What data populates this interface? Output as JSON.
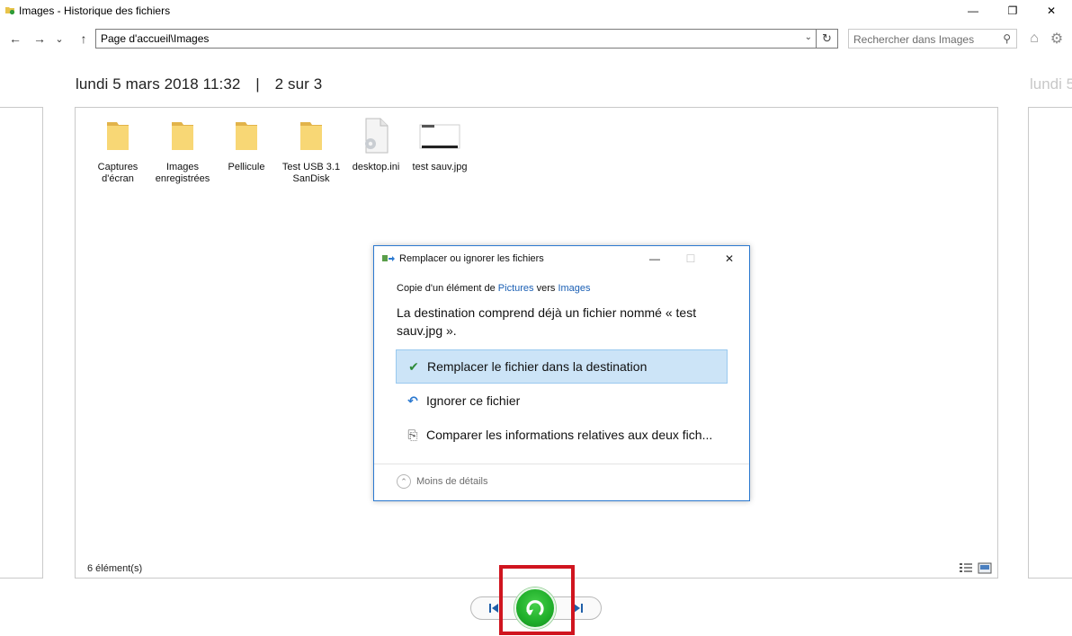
{
  "window": {
    "title": "Images - Historique des fichiers",
    "minimize": "—",
    "restore": "❐",
    "close": "✕"
  },
  "nav": {
    "back": "←",
    "forward": "→",
    "recent": "⌄",
    "up": "↑",
    "address": "Page d'accueil\\Images",
    "address_dropdown": "⌄",
    "refresh": "↻",
    "search_placeholder": "Rechercher dans Images",
    "search_icon": "⚲",
    "home_icon": "⌂",
    "settings_icon": "⚙"
  },
  "snapshot": {
    "date": "lundi 5 mars 2018 11:32",
    "separator": "|",
    "position": "2 sur 3",
    "next_date_peek": "lundi 5"
  },
  "files": [
    {
      "name": "Captures d'écran",
      "type": "folder"
    },
    {
      "name": "Images enregistrées",
      "type": "folder"
    },
    {
      "name": "Pellicule",
      "type": "folder"
    },
    {
      "name": "Test USB 3.1 SanDisk",
      "type": "folder"
    },
    {
      "name": "desktop.ini",
      "type": "settings-file"
    },
    {
      "name": "test sauv.jpg",
      "type": "image"
    }
  ],
  "status": {
    "count": "6 élément(s)"
  },
  "dialog": {
    "title": "Remplacer ou ignorer les fichiers",
    "minimize": "—",
    "maximize": "☐",
    "close": "✕",
    "copy_prefix": "Copie d'un élément de ",
    "copy_source": "Pictures",
    "copy_mid": " vers ",
    "copy_dest": "Images",
    "message": "La destination comprend déjà un fichier nommé « test sauv.jpg ».",
    "options": [
      {
        "icon": "✔",
        "label": "Remplacer le fichier dans la destination",
        "selected": true
      },
      {
        "icon": "↶",
        "label": "Ignorer ce fichier",
        "selected": false
      },
      {
        "icon": "⎘",
        "label": "Comparer les informations relatives aux deux fich...",
        "selected": false
      }
    ],
    "less_details": "Moins de détails",
    "less_icon": "⌃"
  },
  "colors": {
    "accent": "#2b79d0",
    "selection": "#cce4f7",
    "restore_green": "#1fae2a",
    "highlight_red": "#d0151f",
    "folder_yellow": "#f8d775"
  }
}
